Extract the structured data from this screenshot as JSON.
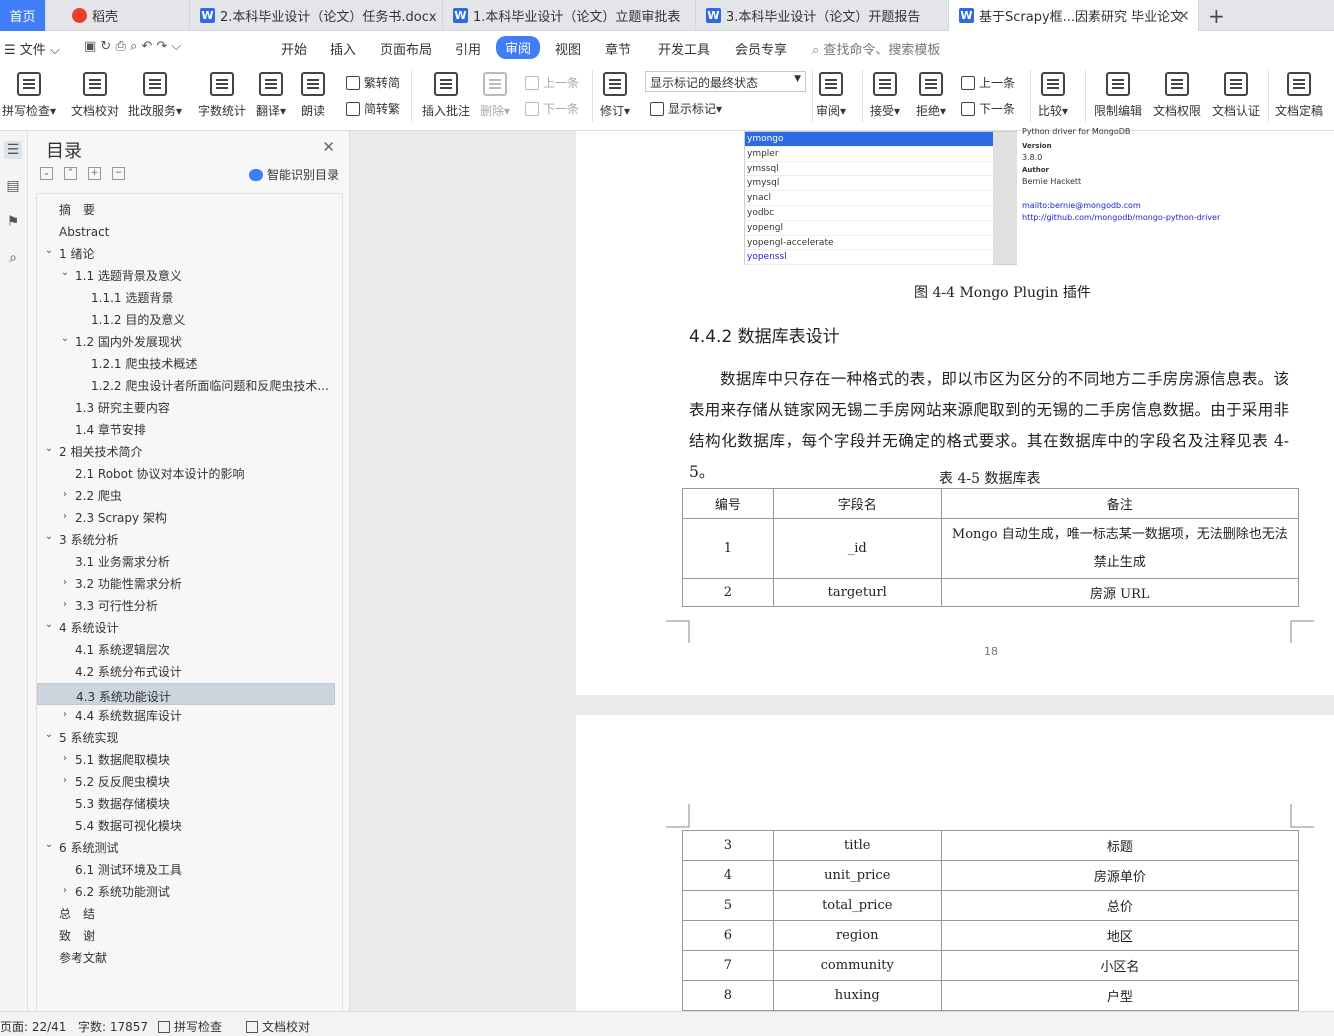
{
  "tabs": [
    {
      "label": "首页"
    },
    {
      "label": "稻壳"
    },
    {
      "label": "2.本科毕业设计（论文）任务书.docx"
    },
    {
      "label": "1.本科毕业设计（论文）立题审批表"
    },
    {
      "label": "3.本科毕业设计（论文）开题报告"
    },
    {
      "label": "基于Scrapy框...因素研究 毕业论文"
    }
  ],
  "menu": {
    "file": "文件",
    "items": [
      "开始",
      "插入",
      "页面布局",
      "引用",
      "审阅",
      "视图",
      "章节",
      "开发工具",
      "会员专享"
    ],
    "search": "查找命令、搜索模板"
  },
  "ribbon": {
    "spell": "拼写检查",
    "proof": "文档校对",
    "review_service": "批改服务",
    "word_count": "字数统计",
    "translate": "翻译",
    "read": "朗读",
    "trad": "繁转简",
    "simp": "简转繁",
    "insert_comment": "插入批注",
    "delete": "删除",
    "prev_comment": "上一条",
    "next_comment": "下一条",
    "track": "修订",
    "display_state": "显示标记的最终状态",
    "show_markup": "显示标记",
    "review": "审阅",
    "accept": "接受",
    "reject": "拒绝",
    "prev_change": "上一条",
    "next_change": "下一条",
    "compare": "比较",
    "restrict": "限制编辑",
    "rights": "文档权限",
    "cert": "文档认证",
    "finalize": "文档定稿"
  },
  "toc": {
    "title": "目录",
    "smart": "智能识别目录",
    "items": [
      {
        "label": "摘　要"
      },
      {
        "label": "Abstract"
      },
      {
        "label": "1  绪论"
      },
      {
        "label": "1.1  选题背景及意义"
      },
      {
        "label": "1.1.1 选题背景"
      },
      {
        "label": "1.1.2 目的及意义"
      },
      {
        "label": "1.2  国内外发展现状"
      },
      {
        "label": "1.2.1  爬虫技术概述"
      },
      {
        "label": "1.2.2  爬虫设计者所面临问题和反爬虫技术..."
      },
      {
        "label": "1.3  研究主要内容"
      },
      {
        "label": "1.4  章节安排"
      },
      {
        "label": "2  相关技术简介"
      },
      {
        "label": "2.1 Robot 协议对本设计的影响"
      },
      {
        "label": "2.2  爬虫"
      },
      {
        "label": "2.3 Scrapy 架构"
      },
      {
        "label": "3  系统分析"
      },
      {
        "label": "3.1  业务需求分析"
      },
      {
        "label": "3.2  功能性需求分析"
      },
      {
        "label": "3.3  可行性分析"
      },
      {
        "label": "4  系统设计"
      },
      {
        "label": "4.1  系统逻辑层次"
      },
      {
        "label": "4.2  系统分布式设计"
      },
      {
        "label": "4.3  系统功能设计"
      },
      {
        "label": "4.4  系统数据库设计"
      },
      {
        "label": "5  系统实现"
      },
      {
        "label": "5.1  数据爬取模块"
      },
      {
        "label": "5.2  反反爬虫模块"
      },
      {
        "label": "5.3  数据存储模块"
      },
      {
        "label": "5.4  数据可视化模块"
      },
      {
        "label": "6  系统测试"
      },
      {
        "label": "6.1  测试环境及工具"
      },
      {
        "label": "6.2  系统功能测试"
      },
      {
        "label": "总　结"
      },
      {
        "label": "致　谢"
      },
      {
        "label": "参考文献"
      }
    ]
  },
  "screenshot": {
    "rows": [
      "ymongo",
      "ympler",
      "ymssql",
      "ymysql",
      "ynacl",
      "yodbc",
      "yopengl",
      "yopengl-accelerate",
      "yopenssl"
    ],
    "info_cut": "Python driver for MongoDB <http://www.mongodb.org>",
    "version_label": "Version",
    "version": "3.8.0",
    "author_label": "Author",
    "author": "Bernie Hackett",
    "mail": "mailto:bernie@mongodb.com",
    "github": "http://github.com/mongodb/mongo-python-driver"
  },
  "doc": {
    "figure_caption": "图 4-4 Mongo Plugin 插件",
    "section_title": "4.4.2  数据库表设计",
    "paragraph": "数据库中只存在一种格式的表，即以市区为区分的不同地方二手房房源信息表。该表用来存储从链家网无锡二手房网站来源爬取到的无锡的二手房信息数据。由于采用非结构化数据库，每个字段并无确定的格式要求。其在数据库中的字段名及注释见表 4-5。",
    "table_caption": "表 4-5 数据库表",
    "headers": [
      "编号",
      "字段名",
      "备注"
    ],
    "rows_page1": [
      {
        "no": "1",
        "field": "_id",
        "note": "Mongo 自动生成，唯一标志某一数据项，无法删除也无法禁止生成"
      },
      {
        "no": "2",
        "field": "targeturl",
        "note": "房源 URL"
      }
    ],
    "page_number": "18",
    "rows_page2": [
      {
        "no": "3",
        "field": "title",
        "note": "标题"
      },
      {
        "no": "4",
        "field": "unit_price",
        "note": "房源单价"
      },
      {
        "no": "5",
        "field": "total_price",
        "note": "总价"
      },
      {
        "no": "6",
        "field": "region",
        "note": "地区"
      },
      {
        "no": "7",
        "field": "community",
        "note": "小区名"
      },
      {
        "no": "8",
        "field": "huxing",
        "note": "户型"
      }
    ]
  },
  "status": {
    "page": "页面: 22/41",
    "words": "字数: 17857",
    "spell": "拼写检查",
    "proof": "文档校对"
  }
}
